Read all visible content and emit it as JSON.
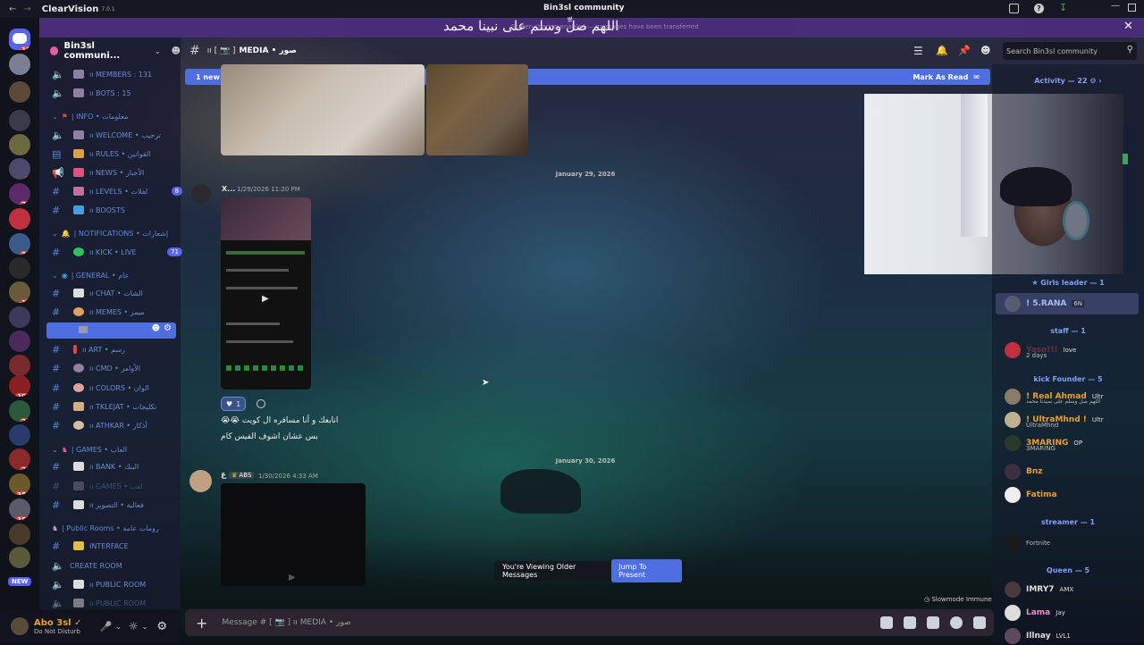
{
  "app": {
    "name": "ClearVision",
    "version": "7.0.1"
  },
  "window": {
    "title": "Bin3sl community"
  },
  "banner": {
    "arabic": "اللهم صلِّ وسلم على نبينا محمد",
    "notice": "Screen sharing enabled — messages have been transferred"
  },
  "server": {
    "name": "Bin3sl communi..."
  },
  "channel": {
    "name": "MEDIA • صور",
    "prefix": "ıı [ 📷 ]"
  },
  "header": {
    "search_placeholder": "Search Bin3sl community"
  },
  "newbar": {
    "text": "1 new message since 2:04 AM",
    "action": "Mark As Read"
  },
  "sidebar": {
    "items": [
      {
        "kind": "channel",
        "label": "ıı MEMBERS : 131",
        "icon": "speaker"
      },
      {
        "kind": "channel",
        "label": "ıı BOTS : 15",
        "icon": "speaker"
      },
      {
        "kind": "category",
        "label": "| INFO • معلومات"
      },
      {
        "kind": "channel",
        "label": "ıı WELCOME • ترحيب",
        "icon": "speaker"
      },
      {
        "kind": "channel",
        "label": "ıı RULES • القوانين",
        "icon": "rules"
      },
      {
        "kind": "channel",
        "label": "ıı NEWS • الأخبار",
        "icon": "megaphone"
      },
      {
        "kind": "channel",
        "label": "ıı LEVELS • لفلات",
        "icon": "hash",
        "badge": "8"
      },
      {
        "kind": "channel",
        "label": "ıı BOOSTS",
        "icon": "hash"
      },
      {
        "kind": "category",
        "label": "| NOTIFICATIONS • إشعارات"
      },
      {
        "kind": "channel",
        "label": "ıı KICK • LIVE",
        "icon": "hash",
        "badge": "71"
      },
      {
        "kind": "category",
        "label": "| GENERAL • عام"
      },
      {
        "kind": "channel",
        "label": "ıı CHAT • الشات",
        "icon": "hash"
      },
      {
        "kind": "channel",
        "label": "ıı MEMES • ميمز",
        "icon": "hash"
      },
      {
        "kind": "channel",
        "label": "",
        "icon": "hash",
        "active": true
      },
      {
        "kind": "channel",
        "label": "ıı ART • رسم",
        "icon": "hash"
      },
      {
        "kind": "channel",
        "label": "ıı CMD • الأوامر",
        "icon": "hash"
      },
      {
        "kind": "channel",
        "label": "ıı COLORS • الوان",
        "icon": "hash"
      },
      {
        "kind": "channel",
        "label": "ıı TKLEJAT • تكليجات",
        "icon": "hash"
      },
      {
        "kind": "channel",
        "label": "ıı ATHKAR • أذكار",
        "icon": "hash"
      },
      {
        "kind": "category",
        "label": "| GAMES • العاب"
      },
      {
        "kind": "channel",
        "label": "ıı BANK • البنك",
        "icon": "hash"
      },
      {
        "kind": "channel",
        "label": "ıı GAMES • لعب",
        "icon": "hash"
      },
      {
        "kind": "channel",
        "label": "ıı فعالية • التصوير",
        "icon": "hash"
      },
      {
        "kind": "category",
        "label": "| Public Rooms • رومات عامة"
      },
      {
        "kind": "channel",
        "label": "INTERFACE",
        "icon": "hash"
      },
      {
        "kind": "channel",
        "label": "CREATE ROOM",
        "icon": "speaker"
      },
      {
        "kind": "channel",
        "label": "ıı PUBLIC ROOM",
        "icon": "speaker"
      },
      {
        "kind": "channel",
        "label": "ıı PUBLIC ROOM",
        "icon": "speaker"
      }
    ]
  },
  "rail": {
    "badges": [
      "12",
      "",
      "",
      "",
      "5",
      "6",
      "",
      "79",
      "2",
      "34",
      "",
      "17",
      "",
      "",
      "",
      "100",
      "27",
      "",
      "28",
      "183",
      "158",
      "",
      "",
      "NEW"
    ]
  },
  "user": {
    "name": "Abo 3sl ✓",
    "status": "Do Not Disturb"
  },
  "messages": {
    "date1": "January 29, 2026",
    "msg1": {
      "author": "X...",
      "time": "1/29/2026 11:20 PM",
      "reaction": "1",
      "text1": "😭😭 انابعك و أنا مسافره ال كويت",
      "text2": "بس عشان اشوف الفيس كام"
    },
    "date2": "January 30, 2026",
    "msg2": {
      "author": "ع",
      "tag": "ABS",
      "time": "1/30/2026 4:33 AM"
    }
  },
  "older": {
    "text": "You're Viewing Older Messages",
    "jump": "Jump To Present"
  },
  "composer": {
    "placeholder": "Message # [ 📷 ] ıı MEDIA • صور"
  },
  "slowmode": "Slowmode Immune",
  "members": {
    "activity": "Activity — 22",
    "groups": [
      {
        "title": "★ Girls leader — 1",
        "color": "#7fa0ff",
        "people": [
          {
            "name": "! 5.RANA",
            "tag": "6N",
            "color": "#a9b8ff"
          }
        ]
      },
      {
        "title": "staff — 1",
        "color": "#7fa0ff",
        "people": [
          {
            "name": "Yaso!!!",
            "tag": "love",
            "sub": "2 days",
            "color": "#e04848"
          }
        ]
      },
      {
        "title": "kick Founder — 5",
        "color": "#7fa0ff",
        "people": [
          {
            "name": "! Real Ahmad",
            "tag": "Ultr",
            "sub": "اللهم صل وسلم على سيدنا محمد",
            "color": "#e8a030"
          },
          {
            "name": "! UltraMhnd !",
            "tag": "Ultr",
            "sub": "UltraMhnd",
            "color": "#e8a030"
          },
          {
            "name": "3MARING",
            "tag": "OP",
            "sub": "3MARING",
            "color": "#e8a030"
          },
          {
            "name": "Bnz",
            "color": "#e8a030"
          },
          {
            "name": "Fatima",
            "color": "#e8a030"
          }
        ]
      },
      {
        "title": "streamer — 1",
        "color": "#7fa0ff",
        "people": [
          {
            "name": "",
            "sub": "Fortnite",
            "color": "#ccc"
          }
        ]
      },
      {
        "title": "Queen — 5",
        "color": "#7fa0ff",
        "people": [
          {
            "name": "IMRY7",
            "tag": "AMX",
            "color": "#dcdcdc"
          },
          {
            "name": "Lama",
            "tag": "Jay",
            "color": "#f08cd0"
          },
          {
            "name": "Illnay",
            "tag": "LVL1",
            "color": "#dcdcdc"
          }
        ]
      }
    ]
  },
  "colors": {
    "accent": "#4f6ee0",
    "purple": "#4a2d7a"
  }
}
